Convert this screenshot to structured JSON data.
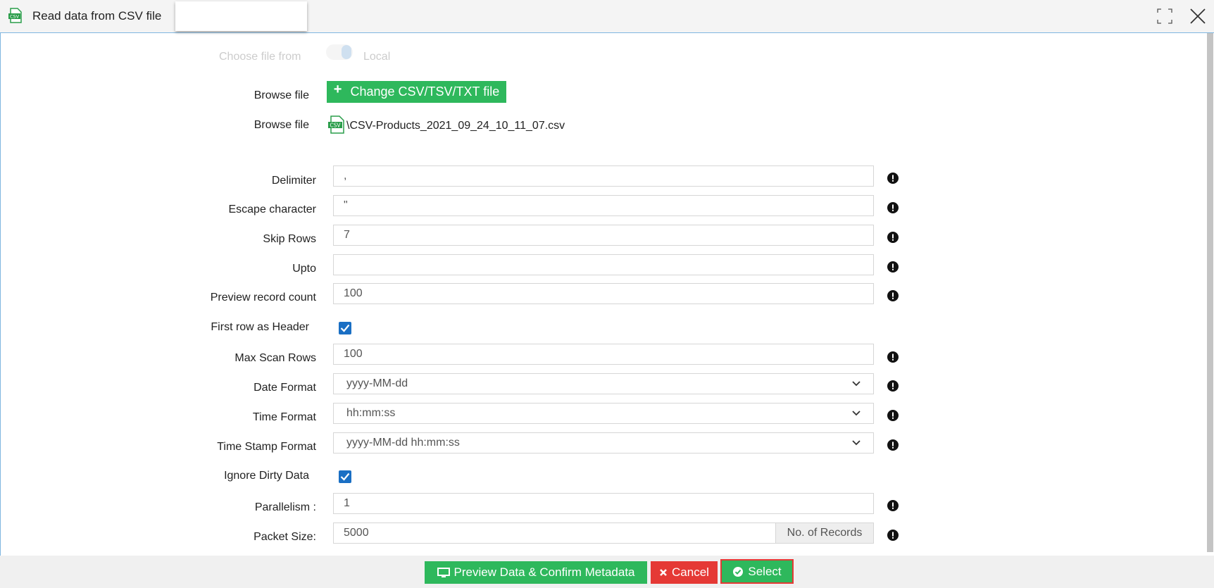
{
  "window": {
    "title": "Read data from CSV file"
  },
  "source": {
    "choose_label": "Choose file from",
    "local_label": "Local"
  },
  "browse": {
    "label_1": "Browse file",
    "change_button": "Change CSV/TSV/TXT file",
    "label_2": "Browse file",
    "file_name": "\\CSV-Products_2021_09_24_10_11_07.csv"
  },
  "form": {
    "delimiter": {
      "label": "Delimiter",
      "value": ","
    },
    "escape": {
      "label": "Escape character",
      "value": "\""
    },
    "skip_rows": {
      "label": "Skip Rows",
      "value": "7"
    },
    "upto": {
      "label": "Upto",
      "value": ""
    },
    "preview_count": {
      "label": "Preview record count",
      "value": "100"
    },
    "first_row_header": {
      "label": "First row as Header",
      "checked": true
    },
    "max_scan_rows": {
      "label": "Max Scan Rows",
      "value": "100"
    },
    "date_format": {
      "label": "Date Format",
      "value": "yyyy-MM-dd"
    },
    "time_format": {
      "label": "Time Format",
      "value": "hh:mm:ss"
    },
    "timestamp_format": {
      "label": "Time Stamp Format",
      "value": "yyyy-MM-dd hh:mm:ss"
    },
    "ignore_dirty": {
      "label": "Ignore Dirty Data",
      "checked": true
    },
    "parallelism": {
      "label": "Parallelism :",
      "value": "1"
    },
    "packet_size": {
      "label": "Packet Size:",
      "value": "5000",
      "addon": "No. of Records"
    }
  },
  "footer": {
    "preview_button": "Preview Data & Confirm Metadata",
    "cancel_button": "Cancel",
    "select_button": "Select"
  },
  "colors": {
    "green": "#2eb85c",
    "red": "#e53935",
    "checkbox": "#1a6fc4"
  }
}
